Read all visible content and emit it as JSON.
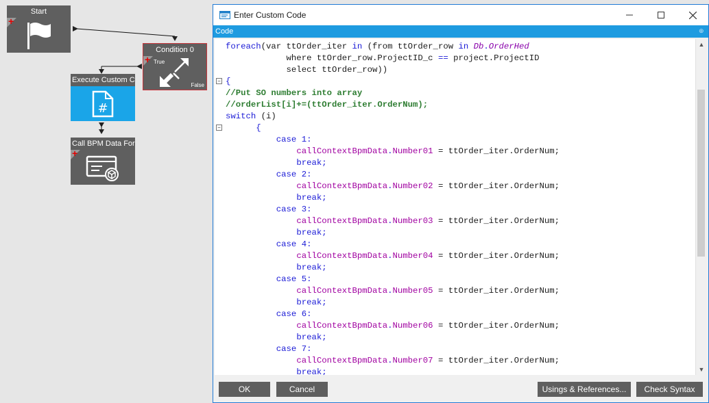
{
  "workflow": {
    "start": {
      "title": "Start"
    },
    "condition": {
      "title": "Condition 0",
      "true_label": "True",
      "false_label": "False"
    },
    "execute": {
      "title": "Execute Custom Co"
    },
    "callbpm": {
      "title": "Call BPM Data Forr"
    }
  },
  "dialog": {
    "title": "Enter Custom Code",
    "tab": "Code",
    "buttons": {
      "ok": "OK",
      "cancel": "Cancel",
      "usings": "Usings & References...",
      "check": "Check Syntax"
    }
  },
  "code": {
    "l1a": "foreach",
    "l1b": "(var ttOrder_iter ",
    "l1c": "in",
    "l1d": " (from ttOrder_row ",
    "l1e": "in",
    "l1f": " ",
    "l1g": "Db",
    "l1h": ".",
    "l1i": "OrderHed",
    "l2a": "            where ttOrder_row.ProjectID_c ",
    "l2b": "==",
    "l2c": " project.ProjectID",
    "l3": "            select ttOrder_row))",
    "l4": "{",
    "l5": "//Put SO numbers into array",
    "l6": "//orderList[i]+=(ttOrder_iter.OrderNum);",
    "l7a": "switch",
    "l7b": " (i)",
    "l8": "      {",
    "cases": [
      {
        "case_kw": "case",
        "num": "1:",
        "obj": "callContextBpmData",
        "field": "Number01",
        "rhs": " = ttOrder_iter.OrderNum;",
        "brk": "break;"
      },
      {
        "case_kw": "case",
        "num": "2:",
        "obj": "callContextBpmData",
        "field": "Number02",
        "rhs": " = ttOrder_iter.OrderNum;",
        "brk": "break;"
      },
      {
        "case_kw": "case",
        "num": "3:",
        "obj": "callContextBpmData",
        "field": "Number03",
        "rhs": " = ttOrder_iter.OrderNum;",
        "brk": "break;"
      },
      {
        "case_kw": "case",
        "num": "4:",
        "obj": "callContextBpmData",
        "field": "Number04",
        "rhs": " = ttOrder_iter.OrderNum;",
        "brk": "break;"
      },
      {
        "case_kw": "case",
        "num": "5:",
        "obj": "callContextBpmData",
        "field": "Number05",
        "rhs": " = ttOrder_iter.OrderNum;",
        "brk": "break;"
      },
      {
        "case_kw": "case",
        "num": "6:",
        "obj": "callContextBpmData",
        "field": "Number06",
        "rhs": " = ttOrder_iter.OrderNum;",
        "brk": "break;"
      },
      {
        "case_kw": "case",
        "num": "7:",
        "obj": "callContextBpmData",
        "field": "Number07",
        "rhs": " = ttOrder_iter.OrderNum;",
        "brk": "break;"
      }
    ]
  },
  "colors": {
    "accent": "#1e9be0",
    "keyword": "#1b1bd6",
    "comment": "#2e7d32",
    "member": "#a000a0",
    "node_bg": "#5f5f5f",
    "execute_node": "#1aa5e8",
    "add_icon": "#e00000"
  },
  "icons": {
    "dialog": "code-window-icon",
    "start": "flag-icon",
    "condition": "condition-arrows-icon",
    "execute": "code-file-hash-icon",
    "callbpm": "data-form-icon",
    "add": "plus-icon"
  }
}
